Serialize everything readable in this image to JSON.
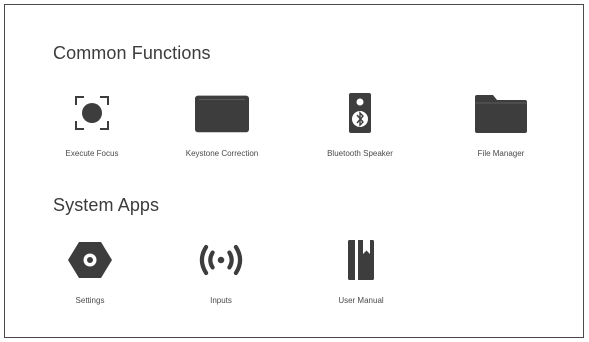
{
  "sections": [
    {
      "title": "Common Functions",
      "items": [
        {
          "label": "Execute Focus",
          "icon": "focus-icon"
        },
        {
          "label": "Keystone Correction",
          "icon": "keystone-icon"
        },
        {
          "label": "Bluetooth Speaker",
          "icon": "bluetooth-speaker-icon"
        },
        {
          "label": "File Manager",
          "icon": "folder-icon"
        }
      ]
    },
    {
      "title": "System Apps",
      "items": [
        {
          "label": "Settings",
          "icon": "settings-icon"
        },
        {
          "label": "Inputs",
          "icon": "inputs-icon"
        },
        {
          "label": "User Manual",
          "icon": "user-manual-icon"
        }
      ]
    }
  ],
  "colors": {
    "icon": "#3d3d3d",
    "text": "#3a3a3a",
    "border": "#4a4a4a",
    "background": "#ffffff"
  }
}
